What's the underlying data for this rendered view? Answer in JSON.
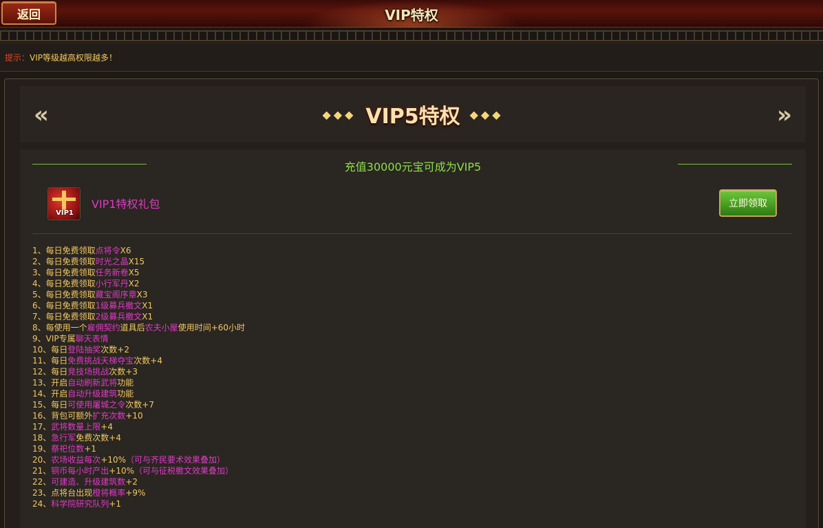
{
  "header": {
    "back_label": "返回",
    "title": "VIP特权"
  },
  "tip": {
    "label": "提示：",
    "text": "VIP等级越高权限越多！"
  },
  "vip": {
    "title": "VIP5特权",
    "recharge_text": "充值30000元宝可成为VIP5",
    "gift_icon_tag": "VIP1",
    "gift_name": "VIP1特权礼包",
    "claim_label": "立即领取",
    "diamonds_left": "◆◆◆",
    "diamonds_right": "◆◆◆"
  },
  "perks": [
    [
      {
        "t": "1、每日免费领取",
        "h": false
      },
      {
        "t": "点将令",
        "h": true
      },
      {
        "t": "X6",
        "h": false
      }
    ],
    [
      {
        "t": "2、每日免费领取",
        "h": false
      },
      {
        "t": "时光之晶",
        "h": true
      },
      {
        "t": "X15",
        "h": false
      }
    ],
    [
      {
        "t": "3、每日免费领取",
        "h": false
      },
      {
        "t": "任务新卷",
        "h": true
      },
      {
        "t": "X5",
        "h": false
      }
    ],
    [
      {
        "t": "4、每日免费领取",
        "h": false
      },
      {
        "t": "小行军丹",
        "h": true
      },
      {
        "t": "X2",
        "h": false
      }
    ],
    [
      {
        "t": "5、每日免费领取",
        "h": false
      },
      {
        "t": "藏宝阁序章",
        "h": true
      },
      {
        "t": "X3",
        "h": false
      }
    ],
    [
      {
        "t": "6、每日免费领取",
        "h": false
      },
      {
        "t": "1级募兵檄文",
        "h": true
      },
      {
        "t": "X1",
        "h": false
      }
    ],
    [
      {
        "t": "7、每日免费领取",
        "h": false
      },
      {
        "t": "2级募兵檄文",
        "h": true
      },
      {
        "t": "X1",
        "h": false
      }
    ],
    [
      {
        "t": "8、每使用一个",
        "h": false
      },
      {
        "t": "雇佣契约",
        "h": true
      },
      {
        "t": "道具后",
        "h": false
      },
      {
        "t": "农夫小屋",
        "h": true
      },
      {
        "t": "使用时间+60小时",
        "h": false
      }
    ],
    [
      {
        "t": "9、VIP专属",
        "h": false
      },
      {
        "t": "聊天表情",
        "h": true
      }
    ],
    [
      {
        "t": "10、每日",
        "h": false
      },
      {
        "t": "登陆抽奖",
        "h": true
      },
      {
        "t": "次数+2",
        "h": false
      }
    ],
    [
      {
        "t": "11、每日",
        "h": false
      },
      {
        "t": "免费挑战天梯夺宝",
        "h": true
      },
      {
        "t": "次数+4",
        "h": false
      }
    ],
    [
      {
        "t": "12、每日",
        "h": false
      },
      {
        "t": "竞技场挑战",
        "h": true
      },
      {
        "t": "次数+3",
        "h": false
      }
    ],
    [
      {
        "t": "13、开启",
        "h": false
      },
      {
        "t": "自动刷新武将",
        "h": true
      },
      {
        "t": "功能",
        "h": false
      }
    ],
    [
      {
        "t": "14、开启",
        "h": false
      },
      {
        "t": "自动升级建筑",
        "h": true
      },
      {
        "t": "功能",
        "h": false
      }
    ],
    [
      {
        "t": "15、每日",
        "h": false
      },
      {
        "t": "可使用屠城之令",
        "h": true
      },
      {
        "t": "次数+7",
        "h": false
      }
    ],
    [
      {
        "t": "16、背包可额外",
        "h": false
      },
      {
        "t": "扩充次数",
        "h": true
      },
      {
        "t": "+10",
        "h": false
      }
    ],
    [
      {
        "t": "17、",
        "h": false
      },
      {
        "t": "武将数量上限",
        "h": true
      },
      {
        "t": "+4",
        "h": false
      }
    ],
    [
      {
        "t": "18、",
        "h": false
      },
      {
        "t": "急行军",
        "h": true
      },
      {
        "t": "免费次数+4",
        "h": false
      }
    ],
    [
      {
        "t": "19、",
        "h": false
      },
      {
        "t": "祭祀位数",
        "h": true
      },
      {
        "t": "+1",
        "h": false
      }
    ],
    [
      {
        "t": "20、",
        "h": false
      },
      {
        "t": "农场收益每次",
        "h": true
      },
      {
        "t": "+10%",
        "h": false
      },
      {
        "t": "（可与齐民要术效果叠加）",
        "h": true
      }
    ],
    [
      {
        "t": "21、",
        "h": false
      },
      {
        "t": "铜币每小时产出",
        "h": true
      },
      {
        "t": "+10%",
        "h": false
      },
      {
        "t": "（可与征税檄文效果叠加）",
        "h": true
      }
    ],
    [
      {
        "t": "22、",
        "h": false
      },
      {
        "t": "可建造、升级建筑数",
        "h": true
      },
      {
        "t": "+2",
        "h": false
      }
    ],
    [
      {
        "t": "23、点将台出现",
        "h": false
      },
      {
        "t": "橙将概率",
        "h": true
      },
      {
        "t": "+9%",
        "h": false
      }
    ],
    [
      {
        "t": "24、",
        "h": false
      },
      {
        "t": "科学院研究队列",
        "h": true
      },
      {
        "t": "+1",
        "h": false
      }
    ]
  ]
}
